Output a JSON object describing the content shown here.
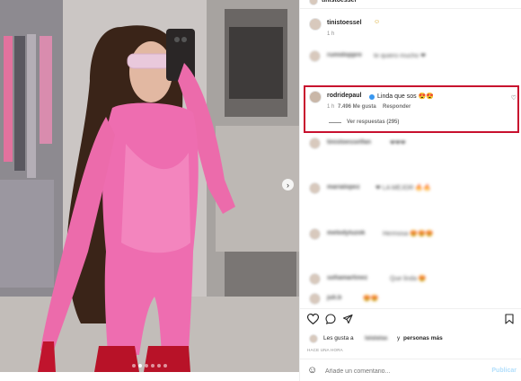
{
  "post": {
    "author": "tinistoessel",
    "media_dots": 6,
    "active_dot": 2
  },
  "caption": {
    "username": "tinistoessel",
    "emoji": "☺",
    "time": "1 h"
  },
  "comments": [
    {
      "username": "rumidoppre",
      "text": "te quiero mucho ❤",
      "blurred": true
    },
    {
      "username": "rodridepaul",
      "verified": true,
      "text": "Linda que sos 😍😍",
      "time": "1 h",
      "likes": "7.496 Me gusta",
      "reply": "Responder",
      "view_replies": "Ver respuestas (295)"
    },
    {
      "username": "tinistoesselfan",
      "text": "❤❤❤",
      "blurred": true
    },
    {
      "username": "marialopez",
      "text": "❤ LA MEJOR 🔥🔥",
      "blurred": true
    },
    {
      "username": "melodyluzok",
      "text": "Hermosa 😍😍😍",
      "blurred": true
    },
    {
      "username": "sofiamartinez",
      "text": "Que linda 😍",
      "blurred": true
    },
    {
      "username": "juli.b",
      "text": "😍😍",
      "blurred": true
    }
  ],
  "likes_line": {
    "prefix": "Les gusta a",
    "blurred_user": "lalalalaa",
    "connector": "y",
    "suffix": "personas más"
  },
  "timestamp": "HACE UNA HORA",
  "comment_box": {
    "placeholder": "Añade un comentario...",
    "publish": "Publicar"
  }
}
